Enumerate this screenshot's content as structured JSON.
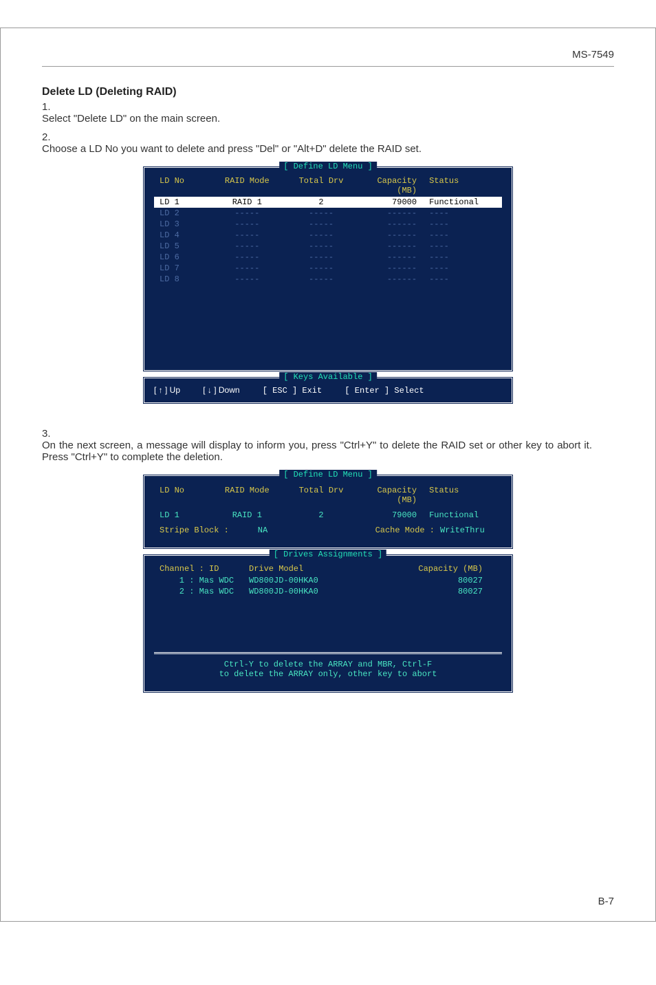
{
  "header": {
    "model": "MS-7549"
  },
  "section_title": "Delete LD (Deleting RAID)",
  "steps": [
    {
      "num": "1.",
      "text": "Select \"Delete LD\" on the main screen."
    },
    {
      "num": "2.",
      "text": "Choose a LD No you want to delete and press \"Del\" or \"Alt+D\" delete the RAID set."
    },
    {
      "num": "3.",
      "text": "On the next screen, a message will display to inform you, press \"Ctrl+Y\" to delete the RAID set or other key to abort it. Press \"Ctrl+Y\" to complete the deletion."
    }
  ],
  "bios1": {
    "panel_title": "[ Define LD Menu ]",
    "headers": {
      "ldno": "LD No",
      "mode": "RAID Mode",
      "drv": "Total Drv",
      "cap": "Capacity (MB)",
      "stat": "Status"
    },
    "selected": {
      "ldno": "LD  1",
      "mode": "RAID 1",
      "drv": "2",
      "cap": "79000",
      "stat": "Functional"
    },
    "rows": [
      {
        "ldno": "LD  2",
        "mode": "-----",
        "drv": "-----",
        "cap": "------",
        "stat": "----"
      },
      {
        "ldno": "LD  3",
        "mode": "-----",
        "drv": "-----",
        "cap": "------",
        "stat": "----"
      },
      {
        "ldno": "LD  4",
        "mode": "-----",
        "drv": "-----",
        "cap": "------",
        "stat": "----"
      },
      {
        "ldno": "LD  5",
        "mode": "-----",
        "drv": "-----",
        "cap": "------",
        "stat": "----"
      },
      {
        "ldno": "LD  6",
        "mode": "-----",
        "drv": "-----",
        "cap": "------",
        "stat": "----"
      },
      {
        "ldno": "LD  7",
        "mode": "-----",
        "drv": "-----",
        "cap": "------",
        "stat": "----"
      },
      {
        "ldno": "LD  8",
        "mode": "-----",
        "drv": "-----",
        "cap": "------",
        "stat": "----"
      }
    ],
    "keys_title": "[ Keys Available ]",
    "keys": {
      "up": "[ ↑ ] Up",
      "down": "[ ↓ ] Down",
      "esc": "[ ESC ] Exit",
      "enter": "[ Enter ] Select"
    }
  },
  "bios2": {
    "panel_title": "[ Define LD Menu ]",
    "headers": {
      "ldno": "LD No",
      "mode": "RAID Mode",
      "drv": "Total Drv",
      "cap": "Capacity (MB)",
      "stat": "Status"
    },
    "row": {
      "ldno": "LD  1",
      "mode": "RAID 1",
      "drv": "2",
      "cap": "79000",
      "stat": "Functional"
    },
    "stripe_label": "Stripe Block :",
    "stripe_value": "NA",
    "cache_label": "Cache Mode :",
    "cache_value": "WriteThru",
    "drives_title": "[ Drives Assignments ]",
    "drives_headers": {
      "ch": "Channel : ID",
      "model": "Drive Model",
      "cap": "Capacity (MB)"
    },
    "drives": [
      {
        "ch": "1 : Mas  WDC",
        "model": "WD800JD-00HKA0",
        "cap": "80027"
      },
      {
        "ch": "2 : Mas  WDC",
        "model": "WD800JD-00HKA0",
        "cap": "80027"
      }
    ],
    "msg1": "Ctrl-Y to delete the ARRAY and MBR, Ctrl-F",
    "msg2": "to delete the ARRAY only, other key to abort"
  },
  "page_number": "B-7"
}
